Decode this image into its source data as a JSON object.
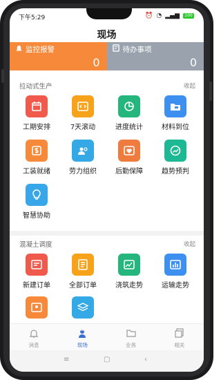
{
  "status": {
    "time": "下午5:29",
    "battery": "100"
  },
  "header": {
    "title": "现场"
  },
  "summary": [
    {
      "label": "监控报警",
      "value": "0",
      "color": "#f7893b"
    },
    {
      "label": "待办事项",
      "value": "0",
      "color": "#9aa3ad"
    }
  ],
  "sections": [
    {
      "title": "拉动式生产",
      "fold": "收起",
      "items": [
        {
          "label": "工期安排",
          "icon": "calendar-icon",
          "color": "#ef5a4c"
        },
        {
          "label": "7天滚动",
          "icon": "code-icon",
          "color": "#f7a21b"
        },
        {
          "label": "进度统计",
          "icon": "pie-chart-icon",
          "color": "#25b67e"
        },
        {
          "label": "材料到位",
          "icon": "folder-icon",
          "color": "#3d8ff0"
        },
        {
          "label": "工装就绪",
          "icon": "dollar-icon",
          "color": "#f7893b"
        },
        {
          "label": "劳力组织",
          "icon": "people-icon",
          "color": "#34a9e5"
        },
        {
          "label": "后勤保障",
          "icon": "heart-icon",
          "color": "#f07b3f"
        },
        {
          "label": "趋势预判",
          "icon": "trend-icon",
          "color": "#1fb894"
        },
        {
          "label": "智慧协助",
          "icon": "bulb-icon",
          "color": "#37a7ea"
        }
      ]
    },
    {
      "title": "混凝土调度",
      "fold": "收起",
      "items": [
        {
          "label": "新建订单",
          "icon": "new-order-icon",
          "color": "#ef5a4c"
        },
        {
          "label": "全部订单",
          "icon": "list-icon",
          "color": "#f7a21b"
        },
        {
          "label": "浇筑走势",
          "icon": "line-chart-icon",
          "color": "#25b67e"
        },
        {
          "label": "运输走势",
          "icon": "bar-chart-icon",
          "color": "#3d8ff0"
        },
        {
          "label": "",
          "icon": "location-icon",
          "color": "#f7893b"
        },
        {
          "label": "",
          "icon": "layers-icon",
          "color": "#34a9e5"
        }
      ]
    }
  ],
  "tabs": [
    {
      "label": "消息",
      "icon": "bell-icon"
    },
    {
      "label": "现场",
      "icon": "worker-icon",
      "active": true
    },
    {
      "label": "业务",
      "icon": "folder-tab-icon"
    },
    {
      "label": "相关",
      "icon": "copy-icon"
    }
  ]
}
